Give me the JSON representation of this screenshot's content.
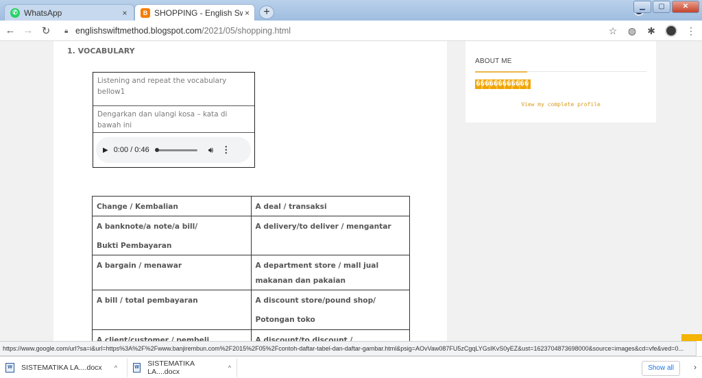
{
  "browser": {
    "tabs": [
      {
        "title": "WhatsApp",
        "close": "×",
        "favicon": "whatsapp-icon"
      },
      {
        "title": "SHOPPING - English Swift Metho",
        "close": "×",
        "favicon": "blogger-icon"
      }
    ],
    "new_tab": "+",
    "url_host": "englishswiftmethod.blogspot.com",
    "url_path": "/2021/05/shopping.html"
  },
  "post": {
    "section_heading": "1. VOCABULARY",
    "audio_box": {
      "line1": "Listening and repeat the vocabulary bellow1",
      "line2": "Dengarkan dan ulangi kosa – kata di bawah ini",
      "time": "0:00 / 0:46"
    },
    "vocab_table": [
      {
        "left": "Change / Kembalian",
        "right": "A deal / transaksi"
      },
      {
        "left": "A banknote/a note/a bill/",
        "left2": "Bukti Pembayaran",
        "right": "A delivery/to deliver / mengantar"
      },
      {
        "left": "A bargain / menawar",
        "right": "A department store / mall jual makanan dan pakaian"
      },
      {
        "left": "A bill / total pembayaran",
        "right": "A discount store/pound shop/",
        "right2": "Potongan toko"
      },
      {
        "left": "A client/customer / pembeli",
        "right": "A discount/to discount /"
      }
    ]
  },
  "sidebar": {
    "about_title": "ABOUT ME",
    "profile_name": "������������",
    "profile_link": "View my complete profile"
  },
  "status_url": "https://www.google.com/url?sa=i&url=https%3A%2F%2Fwww.banjirembun.com%2F2015%2F05%2Fcontoh-daftar-tabel-dan-daftar-gambar.html&psig=AOvVaw087FU5zCgqLYGsIKvS0yEZ&ust=1623704873698000&source=images&cd=vfe&ved=0...",
  "downloads": {
    "items": [
      "SISTEMATIKA LA....docx",
      "SISTEMATIKA LA....docx"
    ],
    "show_all": "Show all"
  },
  "colors": {
    "tabstrip": "#b9d1ea",
    "accent_link": "#1a73e8",
    "sidebar_accent": "#e8b64a"
  }
}
